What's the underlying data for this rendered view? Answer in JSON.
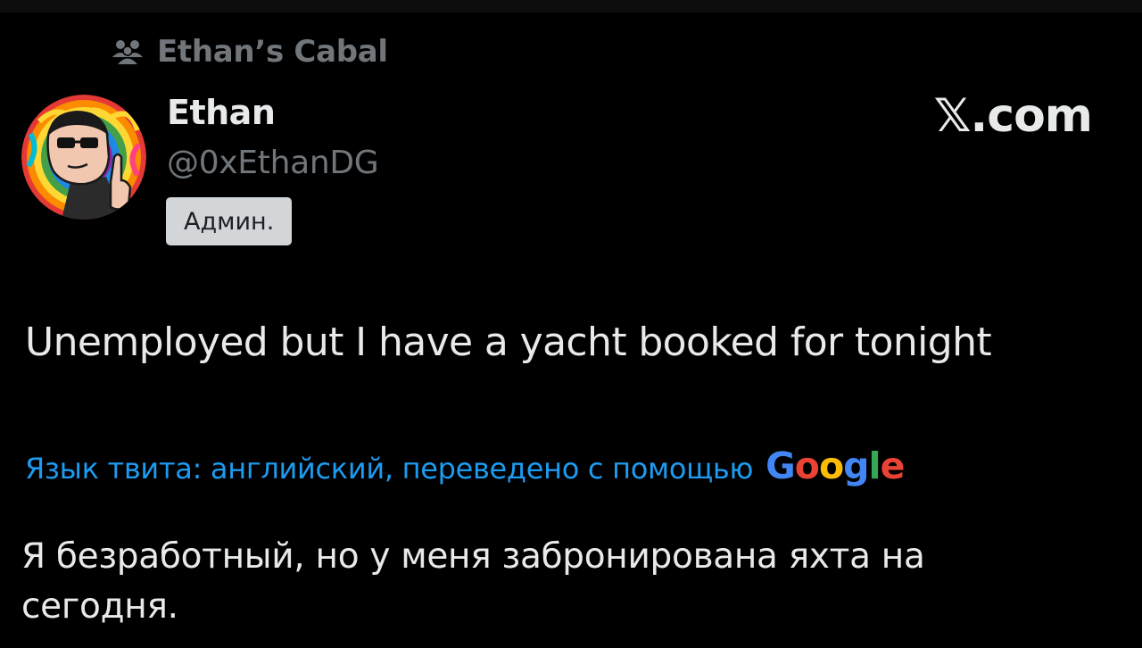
{
  "community": {
    "name": "Ethan’s Cabal",
    "icon": "community-icon"
  },
  "author": {
    "display_name": "Ethan",
    "handle": "@0xEthanDG",
    "role_badge": "Админ.",
    "avatar": "avatar-cartoon"
  },
  "brand": {
    "label": "𝕏.com"
  },
  "tweet": {
    "text": "Unemployed but I have a yacht booked for tonight"
  },
  "translation": {
    "label": "Язык твита: английский, переведено с помощью",
    "provider_letters": [
      "G",
      "o",
      "o",
      "g",
      "l",
      "e"
    ],
    "provider_colors": [
      "#4285f4",
      "#ea4335",
      "#fbbc05",
      "#4285f4",
      "#34a853",
      "#ea4335"
    ],
    "text": "Я безработный, но у меня забронирована яхта на сегодня."
  },
  "colors": {
    "background": "#000000",
    "primary_text": "#e7e9ea",
    "secondary_text": "#71767b",
    "link": "#1d9bf0"
  }
}
